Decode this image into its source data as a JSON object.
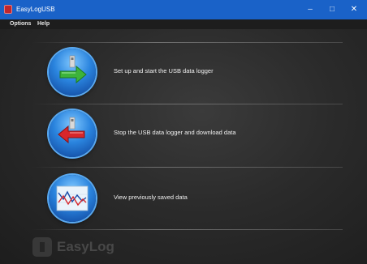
{
  "window": {
    "title": "EasyLogUSB",
    "controls": {
      "minimize": "–",
      "maximize": "□",
      "close": "✕"
    }
  },
  "menu": {
    "items": [
      "Options",
      "Help"
    ]
  },
  "actions": [
    {
      "label": "Set up and start the USB data logger",
      "icon": "usb-start-icon"
    },
    {
      "label": "Stop the USB data logger and download data",
      "icon": "usb-stop-download-icon"
    },
    {
      "label": "View previously saved data",
      "icon": "graph-icon"
    }
  ],
  "footer": {
    "logo_text": "EasyLog"
  },
  "colors": {
    "titlebar": "#1a62c8",
    "icon_blue": "#2a84de",
    "arrow_green": "#3db33a",
    "arrow_red": "#d7262b"
  }
}
